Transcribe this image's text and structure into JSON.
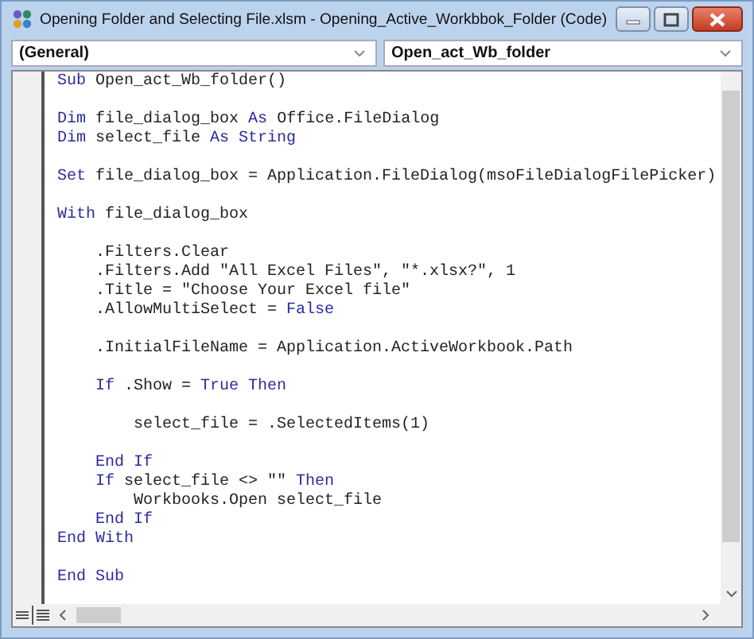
{
  "window": {
    "title": "Opening Folder and Selecting File.xlsm - Opening_Active_Workbbok_Folder (Code)"
  },
  "object_dropdown": {
    "value": "(General)"
  },
  "procedure_dropdown": {
    "value": "Open_act_Wb_folder"
  },
  "code_lines": [
    {
      "gap_before": false,
      "segments": [
        {
          "kind": "keyword",
          "text": "Sub"
        },
        {
          "kind": "plain",
          "text": " Open_act_Wb_folder()"
        }
      ]
    },
    {
      "gap_before": true,
      "segments": [
        {
          "kind": "keyword",
          "text": "Dim"
        },
        {
          "kind": "plain",
          "text": " file_dialog_box "
        },
        {
          "kind": "keyword",
          "text": "As"
        },
        {
          "kind": "plain",
          "text": " Office.FileDialog"
        }
      ]
    },
    {
      "gap_before": false,
      "segments": [
        {
          "kind": "keyword",
          "text": "Dim"
        },
        {
          "kind": "plain",
          "text": " select_file "
        },
        {
          "kind": "keyword",
          "text": "As String"
        }
      ]
    },
    {
      "gap_before": true,
      "segments": [
        {
          "kind": "keyword",
          "text": "Set"
        },
        {
          "kind": "plain",
          "text": " file_dialog_box = Application.FileDialog(msoFileDialogFilePicker)"
        }
      ]
    },
    {
      "gap_before": true,
      "segments": [
        {
          "kind": "keyword",
          "text": "With"
        },
        {
          "kind": "plain",
          "text": " file_dialog_box"
        }
      ]
    },
    {
      "gap_before": true,
      "segments": [
        {
          "kind": "plain",
          "text": "    .Filters.Clear"
        }
      ]
    },
    {
      "gap_before": false,
      "segments": [
        {
          "kind": "plain",
          "text": "    .Filters.Add \"All Excel Files\", \"*.xlsx?\", 1"
        }
      ]
    },
    {
      "gap_before": false,
      "segments": [
        {
          "kind": "plain",
          "text": "    .Title = \"Choose Your Excel file\""
        }
      ]
    },
    {
      "gap_before": false,
      "segments": [
        {
          "kind": "plain",
          "text": "    .AllowMultiSelect = "
        },
        {
          "kind": "keyword",
          "text": "False"
        }
      ]
    },
    {
      "gap_before": true,
      "segments": [
        {
          "kind": "plain",
          "text": "    .InitialFileName = Application.ActiveWorkbook.Path"
        }
      ]
    },
    {
      "gap_before": true,
      "segments": [
        {
          "kind": "keyword",
          "text": "    If"
        },
        {
          "kind": "plain",
          "text": " .Show = "
        },
        {
          "kind": "keyword",
          "text": "True Then"
        }
      ]
    },
    {
      "gap_before": true,
      "segments": [
        {
          "kind": "plain",
          "text": "        select_file = .SelectedItems(1)"
        }
      ]
    },
    {
      "gap_before": true,
      "segments": [
        {
          "kind": "keyword",
          "text": "    End If"
        }
      ]
    },
    {
      "gap_before": false,
      "segments": [
        {
          "kind": "keyword",
          "text": "    If"
        },
        {
          "kind": "plain",
          "text": " select_file <> \"\" "
        },
        {
          "kind": "keyword",
          "text": "Then"
        }
      ]
    },
    {
      "gap_before": false,
      "segments": [
        {
          "kind": "plain",
          "text": "        Workbooks.Open select_file"
        }
      ]
    },
    {
      "gap_before": false,
      "segments": [
        {
          "kind": "keyword",
          "text": "    End If"
        }
      ]
    },
    {
      "gap_before": false,
      "segments": [
        {
          "kind": "keyword",
          "text": "End With"
        }
      ]
    },
    {
      "gap_before": true,
      "segments": [
        {
          "kind": "keyword",
          "text": "End Sub"
        }
      ]
    }
  ]
}
